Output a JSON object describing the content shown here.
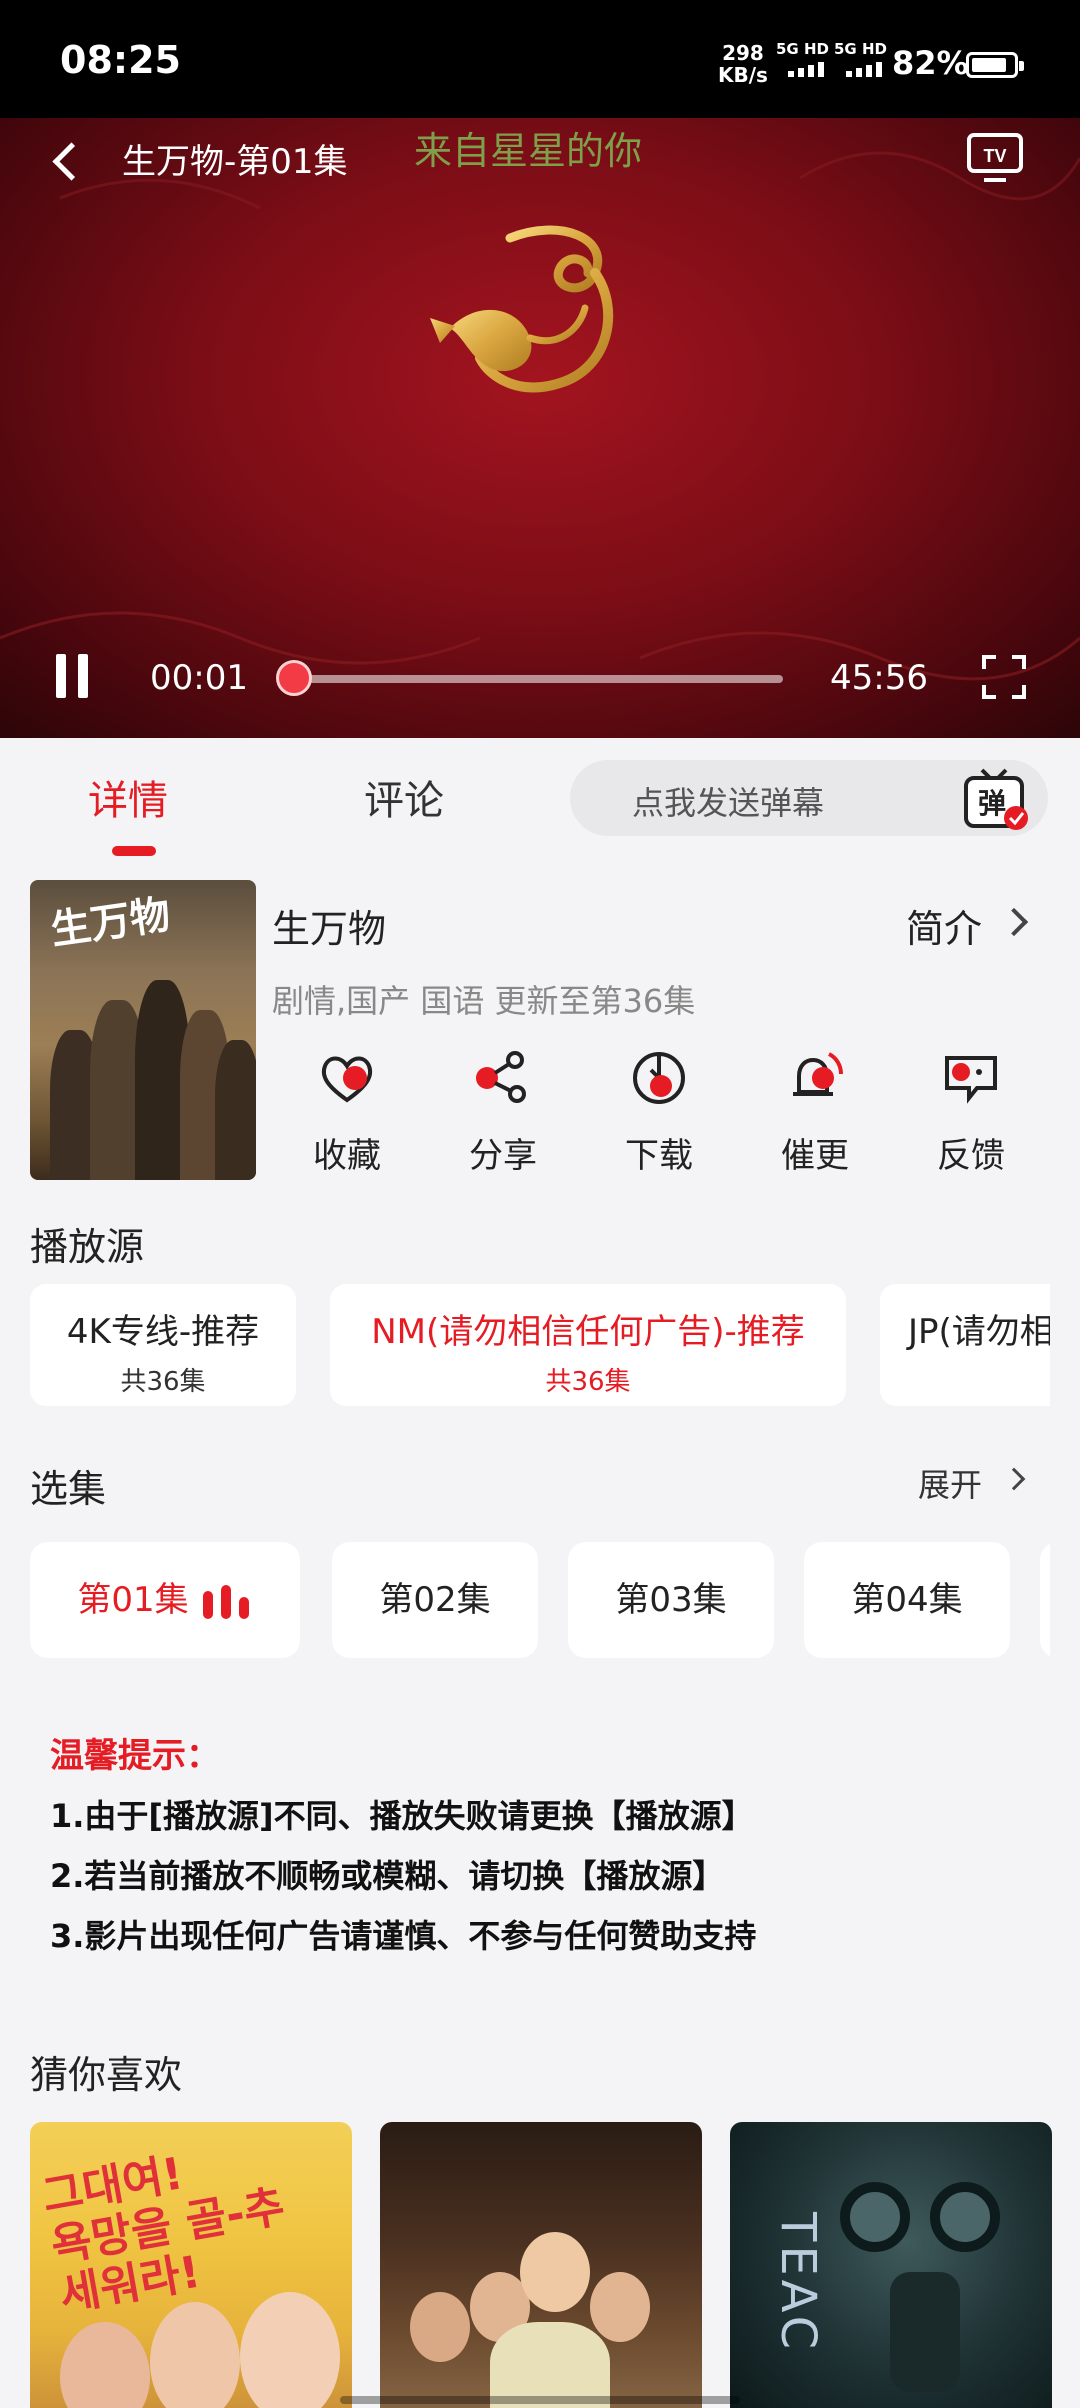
{
  "status_bar": {
    "time": "08:25",
    "speed_value": "298",
    "speed_unit": "KB/s",
    "signal1_label": "5G HD",
    "signal2_label": "5G HD",
    "battery_percent": "82%"
  },
  "player": {
    "title": "生万物-第01集",
    "watermark": "来自星星的你",
    "current_time": "00:01",
    "total_time": "45:56",
    "progress": 0.0004,
    "state": "playing"
  },
  "tabs": [
    {
      "label": "详情",
      "active": true
    },
    {
      "label": "评论",
      "active": false
    }
  ],
  "danmu": {
    "placeholder": "点我发送弹幕",
    "icon_char": "弹"
  },
  "show": {
    "name": "生万物",
    "intro_label": "简介",
    "meta": "剧情,国产 国语 更新至第36集",
    "poster_text": "生万物"
  },
  "actions": [
    {
      "label": "收藏",
      "icon": "heart-icon"
    },
    {
      "label": "分享",
      "icon": "share-icon"
    },
    {
      "label": "下载",
      "icon": "download-icon"
    },
    {
      "label": "催更",
      "icon": "bell-icon"
    },
    {
      "label": "反馈",
      "icon": "feedback-icon"
    }
  ],
  "sources": {
    "title": "播放源",
    "items": [
      {
        "name": "4K专线-推荐",
        "count": "共36集",
        "active": false
      },
      {
        "name": "NM(请勿相信任何广告)-推荐",
        "count": "共36集",
        "active": true
      },
      {
        "name": "JP(请勿相",
        "count": "",
        "active": false
      }
    ]
  },
  "episodes": {
    "title": "选集",
    "expand_label": "展开",
    "items": [
      {
        "label": "第01集",
        "active": true
      },
      {
        "label": "第02集",
        "active": false
      },
      {
        "label": "第03集",
        "active": false
      },
      {
        "label": "第04集",
        "active": false
      }
    ]
  },
  "tips": {
    "title": "温馨提示：",
    "lines": [
      "1.由于[播放源]不同、播放失败请更换【播放源】",
      "2.若当前播放不顺畅或模糊、请切换【播放源】",
      "3.影片出现任何广告请谨慎、不参与任何赞助支持"
    ]
  },
  "recommend": {
    "title": "猜你喜欢",
    "items": [
      {
        "poster_text": "그대여!\n욕망을 골-추\n세워라!"
      },
      {
        "poster_text": ""
      },
      {
        "poster_text": "TEAC"
      }
    ]
  },
  "colors": {
    "accent": "#e51c23",
    "background": "#f4f4f6"
  }
}
